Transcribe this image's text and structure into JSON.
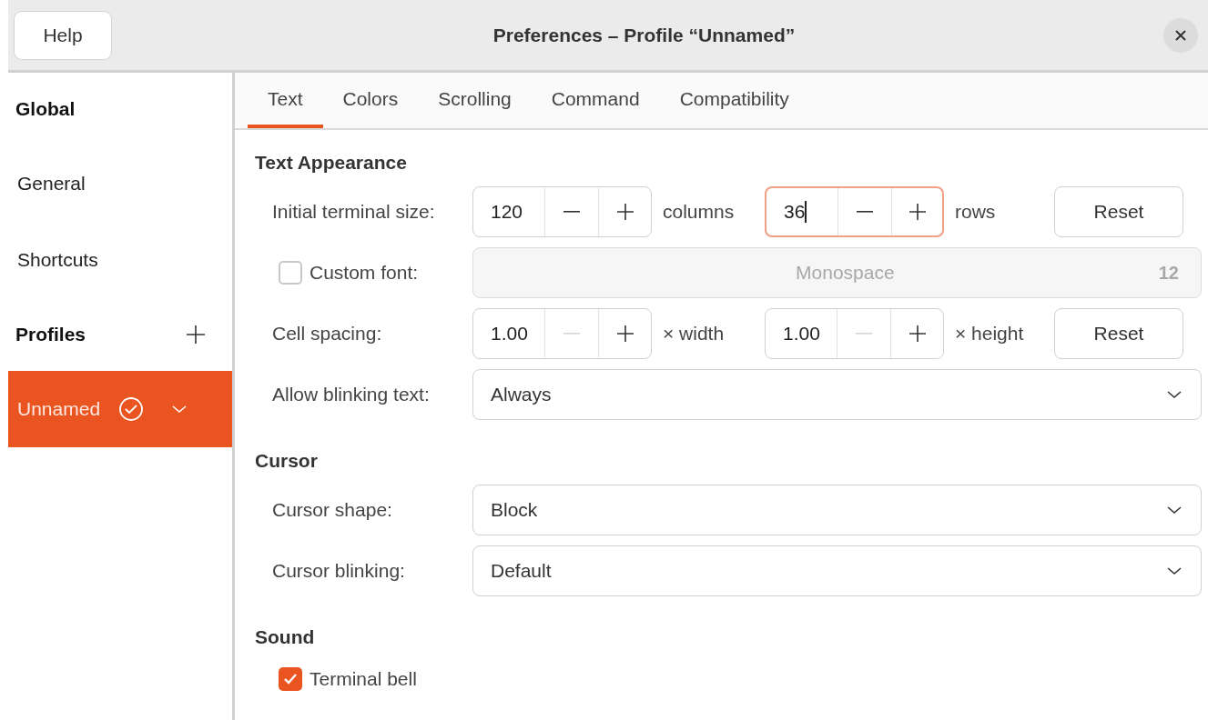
{
  "header": {
    "help_button": "Help",
    "title": "Preferences – Profile “Unnamed”"
  },
  "sidebar": [
    {
      "kind": "heading",
      "label": "Global"
    },
    {
      "kind": "item",
      "label": "General",
      "selected": false
    },
    {
      "kind": "item",
      "label": "Shortcuts",
      "selected": false
    },
    {
      "kind": "heading",
      "label": "Profiles",
      "add": true
    },
    {
      "kind": "profile",
      "label": "Unnamed",
      "selected": true,
      "default": true
    }
  ],
  "tabs": [
    {
      "label": "Text",
      "selected": true
    },
    {
      "label": "Colors",
      "selected": false
    },
    {
      "label": "Scrolling",
      "selected": false
    },
    {
      "label": "Command",
      "selected": false
    },
    {
      "label": "Compatibility",
      "selected": false
    }
  ],
  "sections": [
    {
      "title": "Text Appearance",
      "rows": [
        {
          "kind": "spins",
          "label": "Initial terminal size:",
          "spins": [
            {
              "value": "120",
              "unit": "columns",
              "focused": false,
              "minus_disabled": false
            },
            {
              "value": "36",
              "unit": "rows",
              "focused": true,
              "minus_disabled": false
            }
          ],
          "button": "Reset"
        },
        {
          "kind": "font",
          "label": "Custom font:",
          "checked": false,
          "font": "Monospace",
          "size": "12"
        },
        {
          "kind": "spins",
          "label": "Cell spacing:",
          "spins": [
            {
              "value": "1.00",
              "unit": "× width",
              "focused": false,
              "minus_disabled": true
            },
            {
              "value": "1.00",
              "unit": "× height",
              "focused": false,
              "minus_disabled": true
            }
          ],
          "button": "Reset"
        },
        {
          "kind": "dropdown",
          "label": "Allow blinking text:",
          "value": "Always"
        }
      ]
    },
    {
      "title": "Cursor",
      "rows": [
        {
          "kind": "dropdown",
          "label": "Cursor shape:",
          "value": "Block"
        },
        {
          "kind": "dropdown",
          "label": "Cursor blinking:",
          "value": "Default"
        }
      ]
    },
    {
      "title": "Sound",
      "rows": [
        {
          "kind": "checkbox",
          "label": "Terminal bell",
          "checked": true
        }
      ]
    }
  ]
}
